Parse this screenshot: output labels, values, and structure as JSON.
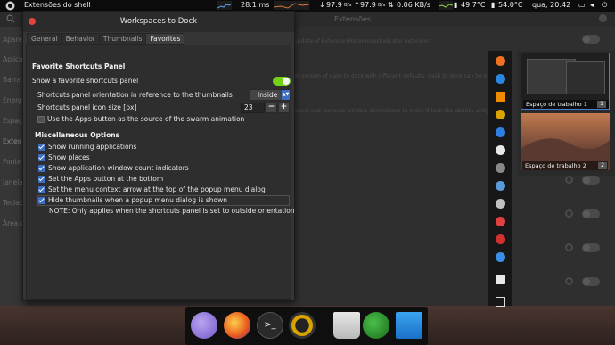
{
  "topbar": {
    "app_name": "Extensões do shell",
    "ping": "28.1 ms",
    "net_down": "97.9",
    "net_down_unit": "B/s",
    "net_up": "97.9",
    "net_up_unit": "B/s",
    "disk": "0.06 KB/s",
    "temp1": "49.7°C",
    "temp2": "54.0°C",
    "clock": "qua, 20:42"
  },
  "background": {
    "title": "Extensões",
    "sidebar": [
      "Apare",
      "Aplica",
      "Barra",
      "Energ",
      "Espaç",
      "Extens",
      "Fonte",
      "Janela",
      "Teclad",
      "Área d"
    ],
    "desc1": "update of ExtensionPreferencesIndicator extension.",
    "desc2": "et version of dash to dock with different defaults: dash to dock can be installe",
    "desc3": "panel and removes window decorations to make it look like ubuntu unity shell."
  },
  "dialog": {
    "title": "Workspaces to Dock",
    "tabs": [
      {
        "label": "General"
      },
      {
        "label": "Behavior"
      },
      {
        "label": "Thumbnails"
      },
      {
        "label": "Favorites"
      }
    ],
    "favorites": {
      "heading": "Favorite Shortcuts Panel",
      "show_label": "Show a favorite shortcuts panel",
      "show_enabled": true,
      "orientation_label": "Shortcuts panel orientation in reference to the thumbnails",
      "orientation_value": "Inside",
      "icon_size_label": "Shortcuts panel icon size [px]",
      "icon_size_value": "23",
      "apps_button_label": "Use the Apps button as the source of the swarm animation",
      "apps_button_checked": false
    },
    "misc": {
      "heading": "Miscellaneous Options",
      "options": [
        {
          "label": "Show running applications",
          "checked": true
        },
        {
          "label": "Show places",
          "checked": true
        },
        {
          "label": "Show application window count indicators",
          "checked": true
        },
        {
          "label": "Set the Apps button at the bottom",
          "checked": true
        },
        {
          "label": "Set the menu context arrow at the top of the popup menu dialog",
          "checked": true
        },
        {
          "label": "Hide thumbnails when a popup menu dialog is shown",
          "checked": true
        }
      ],
      "note": "NOTE: Only applies when the shortcuts panel is set to outside orientation"
    }
  },
  "workspaces": [
    {
      "label": "Espaço de trabalho 1",
      "number": "1"
    },
    {
      "label": "Espaço de trabalho 2",
      "number": "2"
    }
  ],
  "colors": {
    "accent": "#3d6fc5",
    "switch_on": "#73d216",
    "close": "#e0443e"
  }
}
